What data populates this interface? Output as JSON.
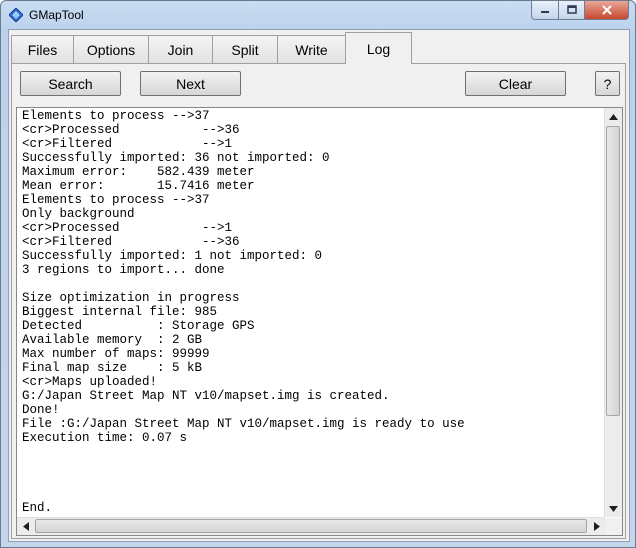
{
  "window": {
    "title": "GMapTool"
  },
  "tabs": [
    {
      "id": "files",
      "label": "Files"
    },
    {
      "id": "options",
      "label": "Options"
    },
    {
      "id": "join",
      "label": "Join"
    },
    {
      "id": "split",
      "label": "Split"
    },
    {
      "id": "write",
      "label": "Write"
    },
    {
      "id": "log",
      "label": "Log"
    }
  ],
  "active_tab": "Log",
  "toolbar": {
    "search_label": "Search",
    "next_label": "Next",
    "clear_label": "Clear",
    "help_label": "?"
  },
  "log": {
    "lines": [
      "Elements to process -->37",
      "<cr>Processed           -->36",
      "<cr>Filtered            -->1",
      "Successfully imported: 36 not imported: 0",
      "Maximum error:    582.439 meter",
      "Mean error:       15.7416 meter",
      "Elements to process -->37",
      "Only background",
      "<cr>Processed           -->1",
      "<cr>Filtered            -->36",
      "Successfully imported: 1 not imported: 0",
      "3 regions to import... done",
      "",
      "Size optimization in progress",
      "Biggest internal file: 985",
      "Detected          : Storage GPS",
      "Available memory  : 2 GB",
      "Max number of maps: 99999",
      "Final map size    : 5 kB",
      "<cr>Maps uploaded!",
      "G:/Japan Street Map NT v10/mapset.img is created.",
      "Done!",
      "File :G:/Japan Street Map NT v10/mapset.img is ready to use",
      "Execution time: 0.07 s",
      "",
      "",
      "",
      "",
      "End."
    ]
  }
}
